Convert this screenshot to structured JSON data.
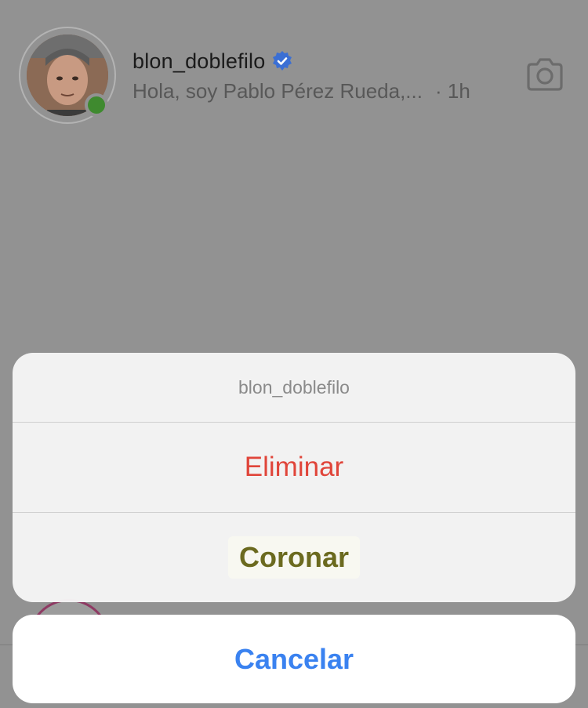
{
  "thread": {
    "username": "blon_doblefilo",
    "preview": "Hola, soy Pablo Pérez Rueda,...",
    "time": "· 1h",
    "avatar_icon": "profile-photo",
    "camera_icon": "camera-icon",
    "verified_icon": "verified-badge-icon",
    "online": true
  },
  "action_sheet": {
    "title": "blon_doblefilo",
    "delete_label": "Eliminar",
    "crown_label": "Coronar",
    "cancel_label": "Cancelar"
  },
  "colors": {
    "overlay": "#929292",
    "delete": "#e0453a",
    "crown": "#6b6a1f",
    "cancel": "#3a82f0",
    "verified": "#3b6fd4",
    "online": "#3f8a2f"
  }
}
